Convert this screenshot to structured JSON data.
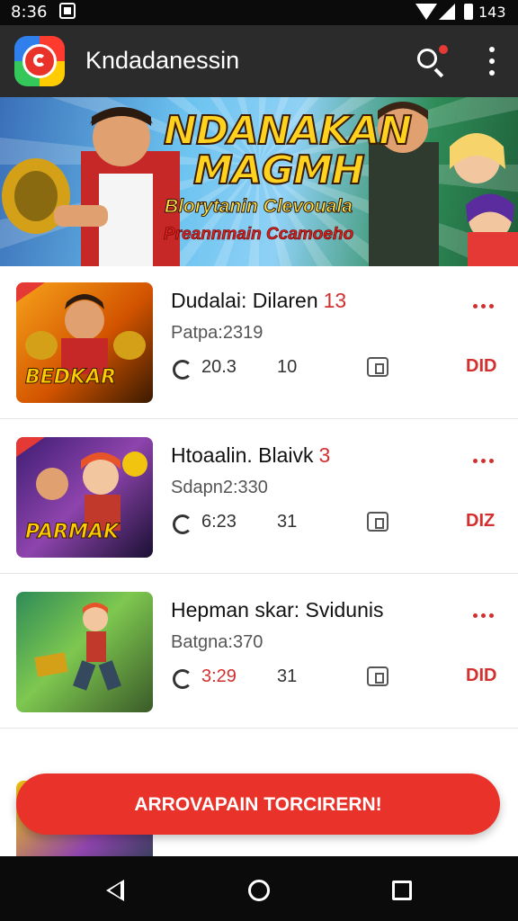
{
  "status_bar": {
    "time": "8:36",
    "battery": "143"
  },
  "app_bar": {
    "title": "Kndadanessin"
  },
  "hero": {
    "title_line1": "NDANAKAN",
    "title_line2": "MAGMH",
    "subtitle_line1": "Blorytanin Clevouala",
    "subtitle_line2": "Preannmain Ccamoeho"
  },
  "list": [
    {
      "title": "Dudalai: Dilaren",
      "badge": "13",
      "sub": "Patpa:2319",
      "stat_a": "20.3",
      "stat_b": "10",
      "stat_c": "DID",
      "thumb_text": "BEDKAR"
    },
    {
      "title": "Htoaalin. Blaivk",
      "badge": "3",
      "sub": "Sdapn2:330",
      "stat_a": "6:23",
      "stat_b": "31",
      "stat_c": "DIZ",
      "thumb_text": "PARMAK"
    },
    {
      "title": "Hepman skar: Svidunis",
      "badge": "",
      "sub": "Batgna:370",
      "stat_a": "3:29",
      "stat_b": "31",
      "stat_c": "DID",
      "thumb_text": ""
    }
  ],
  "fab": {
    "label": "ARROVAPAIN TORCIRERN!"
  },
  "colors": {
    "accent": "#e8322a",
    "appbar": "#2b2b2b",
    "hero_gold": "#ffd21f"
  }
}
